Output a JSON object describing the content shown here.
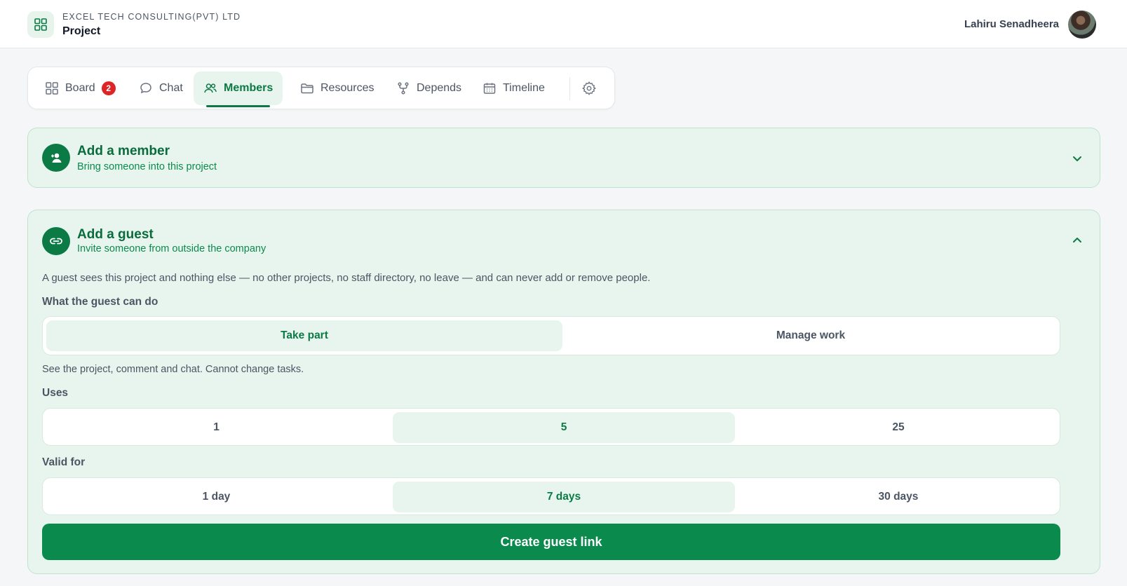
{
  "header": {
    "company": "EXCEL TECH CONSULTING(PVT) LTD",
    "project": "Project",
    "user_name": "Lahiru Senadheera"
  },
  "tabs": [
    {
      "label": "Board",
      "icon": "grid-icon",
      "badge": "2"
    },
    {
      "label": "Chat",
      "icon": "chat-bubble-icon"
    },
    {
      "label": "Members",
      "icon": "users-icon",
      "active": true
    },
    {
      "label": "Resources",
      "icon": "folder-icon"
    },
    {
      "label": "Depends",
      "icon": "git-fork-icon"
    },
    {
      "label": "Timeline",
      "icon": "calendar-icon"
    }
  ],
  "add_member": {
    "title": "Add a member",
    "subtitle": "Bring someone into this project",
    "icon": "user-plus-icon",
    "expanded": false
  },
  "add_guest": {
    "title": "Add a guest",
    "subtitle": "Invite someone from outside the company",
    "icon": "link-icon",
    "expanded": true,
    "description": "A guest sees this project and nothing else — no other projects, no staff directory, no leave — and can never add or remove people.",
    "permission_label": "What the guest can do",
    "permission_options": [
      "Take part",
      "Manage work"
    ],
    "permission_selected": "Take part",
    "permission_hint": "See the project, comment and chat. Cannot change tasks.",
    "uses_label": "Uses",
    "uses_options": [
      "1",
      "5",
      "25"
    ],
    "uses_selected": "5",
    "valid_label": "Valid for",
    "valid_options": [
      "1 day",
      "7 days",
      "30 days"
    ],
    "valid_selected": "7 days",
    "create_button": "Create guest link"
  },
  "colors": {
    "accent": "#0b7a45",
    "panel_bg": "#e8f5ee",
    "badge": "#dc2626"
  }
}
